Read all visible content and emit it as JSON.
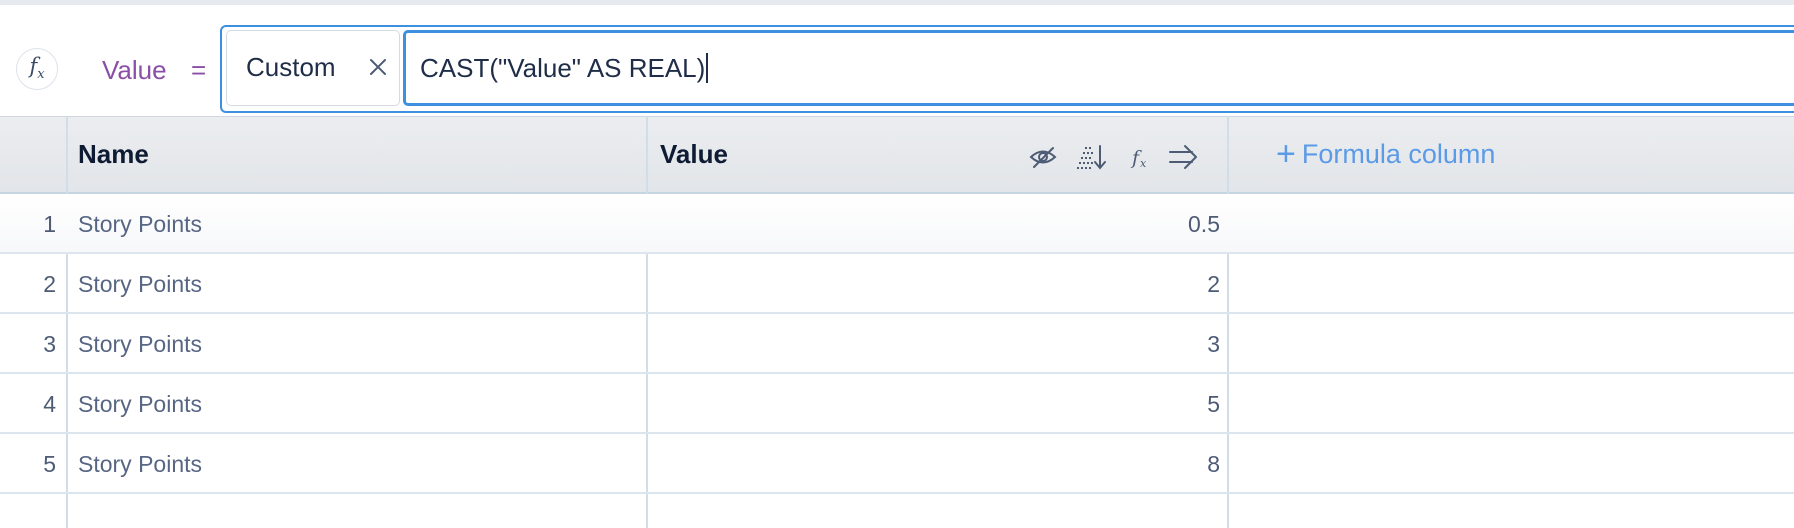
{
  "formula_bar": {
    "fx_icon": "function-fx-icon",
    "field_name": "Value",
    "equals": "=",
    "mode": "Custom",
    "expression": "CAST(\"Value\" AS REAL)"
  },
  "table": {
    "columns": [
      {
        "label": "Name"
      },
      {
        "label": "Value"
      }
    ],
    "value_column_icons": [
      "hide-eye-icon",
      "sort-descending-icon",
      "function-fx-icon",
      "wrap-arrow-icon"
    ],
    "add_formula_label": "Formula column",
    "rows": [
      {
        "num": "1",
        "name": "Story Points",
        "value": "0.5"
      },
      {
        "num": "2",
        "name": "Story Points",
        "value": "2"
      },
      {
        "num": "3",
        "name": "Story Points",
        "value": "3"
      },
      {
        "num": "4",
        "name": "Story Points",
        "value": "5"
      },
      {
        "num": "5",
        "name": "Story Points",
        "value": "8"
      }
    ]
  },
  "colors": {
    "accent": "#3d8fe0",
    "field_name": "#8a4fa6",
    "link": "#5b9ae6"
  }
}
